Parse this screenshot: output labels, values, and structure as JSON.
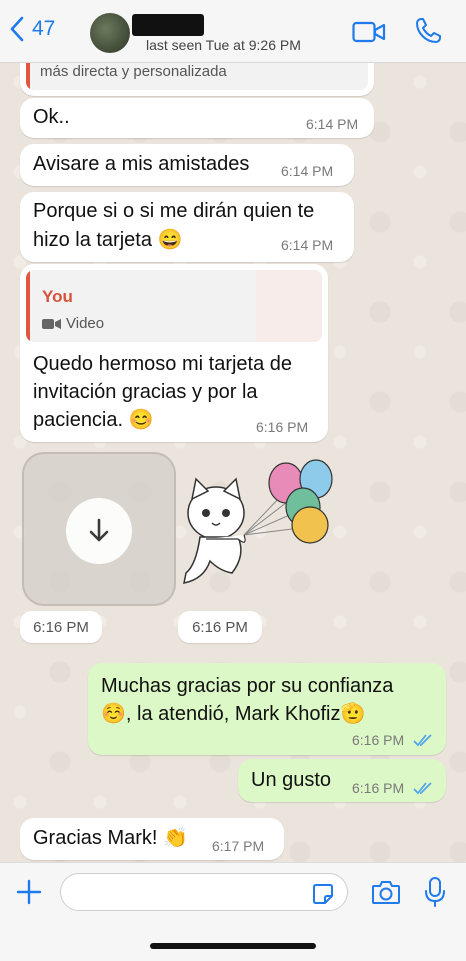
{
  "header": {
    "back_count": "47",
    "contact_name": "",
    "last_seen": "last seen Tue at 9:26 PM"
  },
  "messages": [
    {
      "type": "in",
      "text": "más directa y personalizada",
      "partial": true
    },
    {
      "type": "in",
      "text": "Ok..",
      "time": "6:14 PM"
    },
    {
      "type": "in",
      "text": "Avisare a mis amistades",
      "time": "6:14 PM"
    },
    {
      "type": "in",
      "line1": "Porque si o si me dirán quien te",
      "line2": "hizo la tarjeta 😄",
      "time": "6:14 PM"
    },
    {
      "type": "in",
      "quote_author": "You",
      "quote_media": "Video",
      "line1": "Quedo hermoso mi tarjeta de",
      "line2": "invitación gracias y por la",
      "line3": "paciencia.  😊",
      "time": "6:16 PM"
    },
    {
      "type": "media",
      "time": "6:16 PM"
    },
    {
      "type": "sticker",
      "time": "6:16 PM"
    },
    {
      "type": "out",
      "line1": "Muchas gracias por su confianza",
      "line2": "☺️, la atendió, Mark Khofiz🫡",
      "time": "6:16 PM"
    },
    {
      "type": "out",
      "text": "Un gusto",
      "time": "6:16 PM"
    },
    {
      "type": "in",
      "text": "Gracias Mark! 👏",
      "time": "6:17 PM"
    }
  ],
  "composer": {
    "value": "",
    "placeholder": ""
  },
  "colors": {
    "accent": "#1f7aeb",
    "outgoing_bubble": "#dcf8c6",
    "incoming_bubble": "#ffffff",
    "quote_author": "#d9533a",
    "read_ticks": "#53a6e8"
  },
  "icons": [
    "chevron-left-icon",
    "video-call-icon",
    "phone-icon",
    "video-camera-icon",
    "download-icon",
    "plus-icon",
    "sticker-icon",
    "camera-icon",
    "mic-icon",
    "double-check-icon"
  ]
}
